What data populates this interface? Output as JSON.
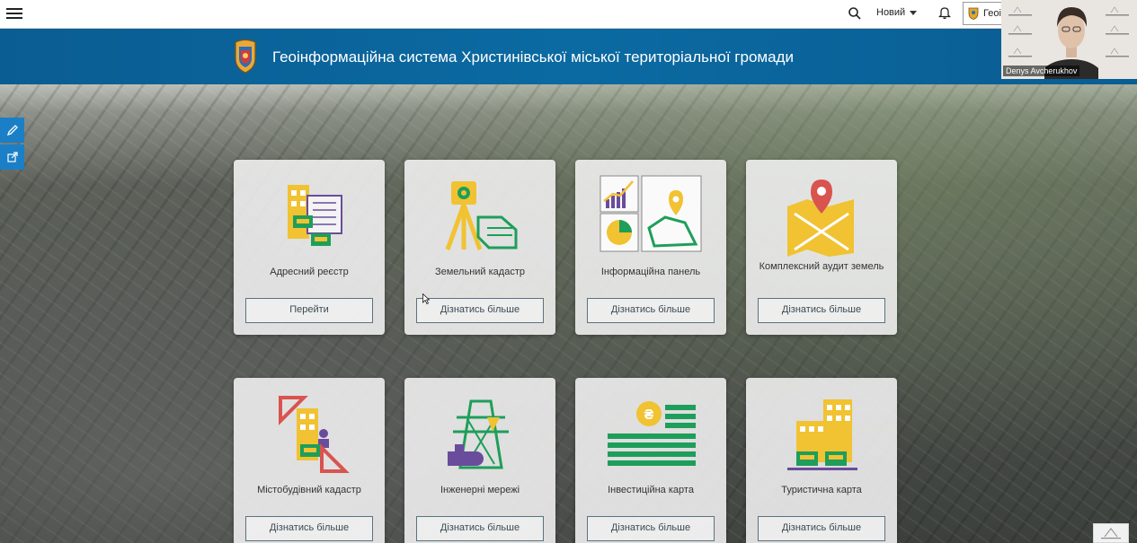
{
  "header": {
    "menu_icon": "hamburger-icon",
    "search_icon": "search-icon",
    "new_label": "Новий",
    "bell_icon": "bell-icon",
    "user_label": "Геоі"
  },
  "banner": {
    "title": "Геоінформаційна система Христинівської міської територіальної громади"
  },
  "side_tools": [
    {
      "icon": "pencil-icon"
    },
    {
      "icon": "share-icon"
    }
  ],
  "cards": [
    {
      "title": "Адресний реєстр",
      "button": "Перейти",
      "icon": "address-registry-icon"
    },
    {
      "title": "Земельний кадастр",
      "button": "Дізнатись більше",
      "icon": "land-cadastre-icon"
    },
    {
      "title": "Інформаційна панель",
      "button": "Дізнатись більше",
      "icon": "info-panel-icon"
    },
    {
      "title": "Комплексний аудит земель",
      "button": "Дізнатись більше",
      "icon": "land-audit-icon"
    },
    {
      "title": "Містобудівний кадастр",
      "button": "Дізнатись більше",
      "icon": "urban-cadastre-icon"
    },
    {
      "title": "Інженерні мережі",
      "button": "Дізнатись більше",
      "icon": "engineering-networks-icon"
    },
    {
      "title": "Інвестиційна карта",
      "button": "Дізнатись більше",
      "icon": "investment-map-icon"
    },
    {
      "title": "Туристична карта",
      "button": "Дізнатись більше",
      "icon": "tourist-map-icon"
    }
  ],
  "webcam": {
    "name": "Denys Avcherukhov"
  },
  "colors": {
    "banner": "#0b6aa2",
    "icon_yellow": "#f1c232",
    "icon_green": "#1e9e5a",
    "icon_red": "#d9534f",
    "icon_purple": "#6a4c9c"
  }
}
